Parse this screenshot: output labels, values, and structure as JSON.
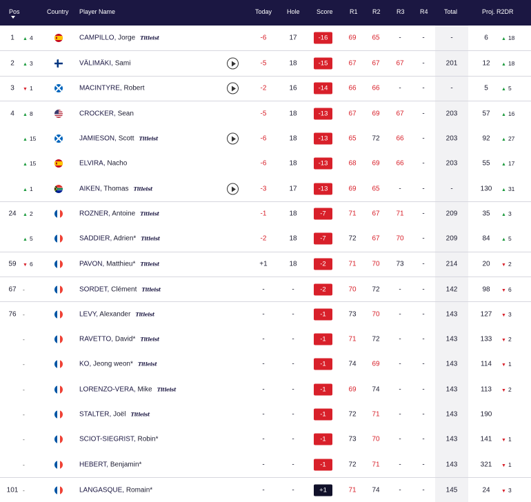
{
  "header": {
    "pos": "Pos",
    "country": "Country",
    "player": "Player Name",
    "today": "Today",
    "hole": "Hole",
    "score": "Score",
    "r1": "R1",
    "r2": "R2",
    "r3": "R3",
    "r4": "R4",
    "total": "Total",
    "proj": "Proj. R2DR"
  },
  "colors": {
    "header_bg": "#1b1742",
    "under_par": "#d8202a",
    "over_par_badge": "#11112a",
    "up": "#1a9a3c",
    "down": "#d8202a"
  },
  "rows": [
    {
      "pos": "1",
      "mv": "4",
      "dir": "up",
      "flag": "es",
      "last": "CAMPILLO,",
      "first": "Jorge",
      "titleist": true,
      "play": false,
      "today": "-6",
      "hole": "17",
      "score": "-16",
      "r1": "69",
      "r2": "65",
      "r3": "-",
      "r4": "-",
      "total": "-",
      "proj": "6",
      "r2dr": "18",
      "r2dir": "up",
      "sep": false
    },
    {
      "pos": "2",
      "mv": "3",
      "dir": "up",
      "flag": "fi",
      "last": "VÄLIMÄKI,",
      "first": "Sami",
      "titleist": false,
      "play": true,
      "today": "-5",
      "hole": "18",
      "score": "-15",
      "r1": "67",
      "r2": "67",
      "r3": "67",
      "r4": "-",
      "total": "201",
      "proj": "12",
      "r2dr": "18",
      "r2dir": "up",
      "sep": true
    },
    {
      "pos": "3",
      "mv": "1",
      "dir": "dn",
      "flag": "sc",
      "last": "MACINTYRE,",
      "first": "Robert",
      "titleist": false,
      "play": true,
      "today": "-2",
      "hole": "16",
      "score": "-14",
      "r1": "66",
      "r2": "66",
      "r3": "-",
      "r4": "-",
      "total": "-",
      "proj": "5",
      "r2dr": "5",
      "r2dir": "up",
      "sep": true
    },
    {
      "pos": "4",
      "mv": "8",
      "dir": "up",
      "flag": "us",
      "last": "CROCKER,",
      "first": "Sean",
      "titleist": false,
      "play": false,
      "today": "-5",
      "hole": "18",
      "score": "-13",
      "r1": "67",
      "r2": "69",
      "r3": "67",
      "r4": "-",
      "total": "203",
      "proj": "57",
      "r2dr": "16",
      "r2dir": "up",
      "sep": true
    },
    {
      "pos": "",
      "mv": "15",
      "dir": "up",
      "flag": "sc",
      "last": "JAMIESON,",
      "first": "Scott",
      "titleist": true,
      "play": true,
      "today": "-6",
      "hole": "18",
      "score": "-13",
      "r1": "65",
      "r2": "72",
      "r3": "66",
      "r4": "-",
      "total": "203",
      "proj": "92",
      "r2dr": "27",
      "r2dir": "up",
      "sep": false
    },
    {
      "pos": "",
      "mv": "15",
      "dir": "up",
      "flag": "es",
      "last": "ELVIRA,",
      "first": "Nacho",
      "titleist": false,
      "play": false,
      "today": "-6",
      "hole": "18",
      "score": "-13",
      "r1": "68",
      "r2": "69",
      "r3": "66",
      "r4": "-",
      "total": "203",
      "proj": "55",
      "r2dr": "17",
      "r2dir": "up",
      "sep": false
    },
    {
      "pos": "",
      "mv": "1",
      "dir": "up",
      "flag": "za",
      "last": "AIKEN,",
      "first": "Thomas",
      "titleist": true,
      "play": true,
      "today": "-3",
      "hole": "17",
      "score": "-13",
      "r1": "69",
      "r2": "65",
      "r3": "-",
      "r4": "-",
      "total": "-",
      "proj": "130",
      "r2dr": "31",
      "r2dir": "up",
      "sep": false
    },
    {
      "pos": "24",
      "mv": "2",
      "dir": "up",
      "flag": "fr",
      "last": "ROZNER,",
      "first": "Antoine",
      "titleist": true,
      "play": false,
      "today": "-1",
      "hole": "18",
      "score": "-7",
      "r1": "71",
      "r2": "67",
      "r3": "71",
      "r4": "-",
      "total": "209",
      "proj": "35",
      "r2dr": "3",
      "r2dir": "up",
      "sep": true
    },
    {
      "pos": "",
      "mv": "5",
      "dir": "up",
      "flag": "fr",
      "last": "SADDIER,",
      "first": "Adrien*",
      "titleist": true,
      "play": false,
      "today": "-2",
      "hole": "18",
      "score": "-7",
      "r1": "72",
      "r2": "67",
      "r3": "70",
      "r4": "-",
      "total": "209",
      "proj": "84",
      "r2dr": "5",
      "r2dir": "up",
      "sep": false
    },
    {
      "pos": "59",
      "mv": "6",
      "dir": "dn",
      "flag": "fr",
      "last": "PAVON,",
      "first": "Matthieu*",
      "titleist": true,
      "play": false,
      "today": "+1",
      "hole": "18",
      "score": "-2",
      "r1": "71",
      "r2": "70",
      "r3": "73",
      "r4": "-",
      "total": "214",
      "proj": "20",
      "r2dr": "2",
      "r2dir": "dn",
      "sep": true
    },
    {
      "pos": "67",
      "mv": "-",
      "dir": "none",
      "flag": "fr",
      "last": "SORDET,",
      "first": "Clément",
      "titleist": true,
      "play": false,
      "today": "-",
      "hole": "-",
      "score": "-2",
      "r1": "70",
      "r2": "72",
      "r3": "-",
      "r4": "-",
      "total": "142",
      "proj": "98",
      "r2dr": "6",
      "r2dir": "dn",
      "sep": true
    },
    {
      "pos": "76",
      "mv": "-",
      "dir": "none",
      "flag": "fr",
      "last": "LEVY,",
      "first": "Alexander",
      "titleist": true,
      "play": false,
      "today": "-",
      "hole": "-",
      "score": "-1",
      "r1": "73",
      "r2": "70",
      "r3": "-",
      "r4": "-",
      "total": "143",
      "proj": "127",
      "r2dr": "3",
      "r2dir": "dn",
      "sep": true
    },
    {
      "pos": "",
      "mv": "-",
      "dir": "none",
      "flag": "fr",
      "last": "RAVETTO,",
      "first": "David*",
      "titleist": true,
      "play": false,
      "today": "-",
      "hole": "-",
      "score": "-1",
      "r1": "71",
      "r2": "72",
      "r3": "-",
      "r4": "-",
      "total": "143",
      "proj": "133",
      "r2dr": "2",
      "r2dir": "dn",
      "sep": false
    },
    {
      "pos": "",
      "mv": "-",
      "dir": "none",
      "flag": "fr",
      "last": "KO,",
      "first": "Jeong weon*",
      "titleist": true,
      "play": false,
      "today": "-",
      "hole": "-",
      "score": "-1",
      "r1": "74",
      "r2": "69",
      "r3": "-",
      "r4": "-",
      "total": "143",
      "proj": "114",
      "r2dr": "1",
      "r2dir": "dn",
      "sep": false
    },
    {
      "pos": "",
      "mv": "-",
      "dir": "none",
      "flag": "fr",
      "last": "LORENZO-VERA,",
      "first": "Mike",
      "titleist": true,
      "play": false,
      "today": "-",
      "hole": "-",
      "score": "-1",
      "r1": "69",
      "r2": "74",
      "r3": "-",
      "r4": "-",
      "total": "143",
      "proj": "113",
      "r2dr": "2",
      "r2dir": "dn",
      "sep": false
    },
    {
      "pos": "",
      "mv": "-",
      "dir": "none",
      "flag": "fr",
      "last": "STALTER,",
      "first": "Joël",
      "titleist": true,
      "play": false,
      "today": "-",
      "hole": "-",
      "score": "-1",
      "r1": "72",
      "r2": "71",
      "r3": "-",
      "r4": "-",
      "total": "143",
      "proj": "190",
      "r2dr": "",
      "r2dir": "none",
      "sep": false
    },
    {
      "pos": "",
      "mv": "-",
      "dir": "none",
      "flag": "fr",
      "last": "SCIOT-SIEGRIST,",
      "first": "Robin*",
      "titleist": false,
      "play": false,
      "today": "-",
      "hole": "-",
      "score": "-1",
      "r1": "73",
      "r2": "70",
      "r3": "-",
      "r4": "-",
      "total": "143",
      "proj": "141",
      "r2dr": "1",
      "r2dir": "dn",
      "sep": false
    },
    {
      "pos": "",
      "mv": "-",
      "dir": "none",
      "flag": "fr",
      "last": "HEBERT,",
      "first": "Benjamin*",
      "titleist": false,
      "play": false,
      "today": "-",
      "hole": "-",
      "score": "-1",
      "r1": "72",
      "r2": "71",
      "r3": "-",
      "r4": "-",
      "total": "143",
      "proj": "321",
      "r2dr": "1",
      "r2dir": "dn",
      "sep": false
    },
    {
      "pos": "101",
      "mv": "-",
      "dir": "none",
      "flag": "fr",
      "last": "LANGASQUE,",
      "first": "Romain*",
      "titleist": false,
      "play": false,
      "today": "-",
      "hole": "-",
      "score": "+1",
      "r1": "71",
      "r2": "74",
      "r3": "-",
      "r4": "-",
      "total": "145",
      "proj": "24",
      "r2dr": "3",
      "r2dir": "dn",
      "sep": true
    }
  ],
  "titleist_label": "Titleist"
}
